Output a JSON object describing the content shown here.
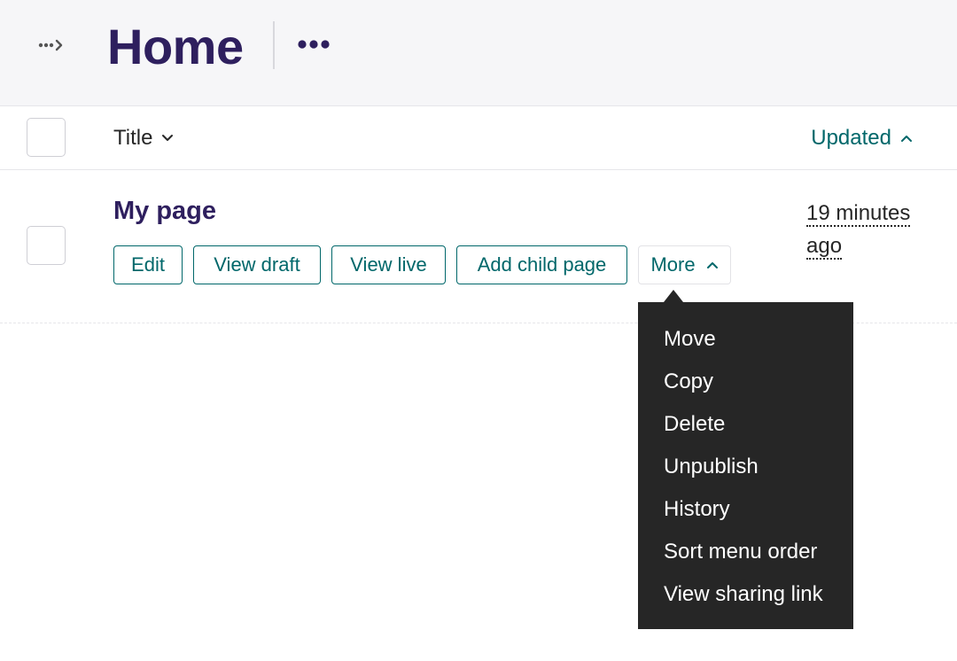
{
  "header": {
    "title": "Home",
    "breadcrumb_icon": "breadcrumb-expand-icon",
    "actions_icon": "more-actions-icon"
  },
  "table": {
    "columns": {
      "title": "Title",
      "updated": "Updated"
    },
    "rows": [
      {
        "title": "My page",
        "updated_line1": "19 minutes",
        "updated_line2": "ago",
        "actions": [
          "Edit",
          "View draft",
          "View live",
          "Add child page"
        ],
        "more_label": "More"
      }
    ]
  },
  "dropdown": {
    "items": [
      "Move",
      "Copy",
      "Delete",
      "Unpublish",
      "History",
      "Sort menu order",
      "View sharing link"
    ]
  },
  "colors": {
    "title": "#2e1f5e",
    "accent": "#00676a",
    "menu_bg": "#262626",
    "header_bg": "#f6f6f8"
  }
}
